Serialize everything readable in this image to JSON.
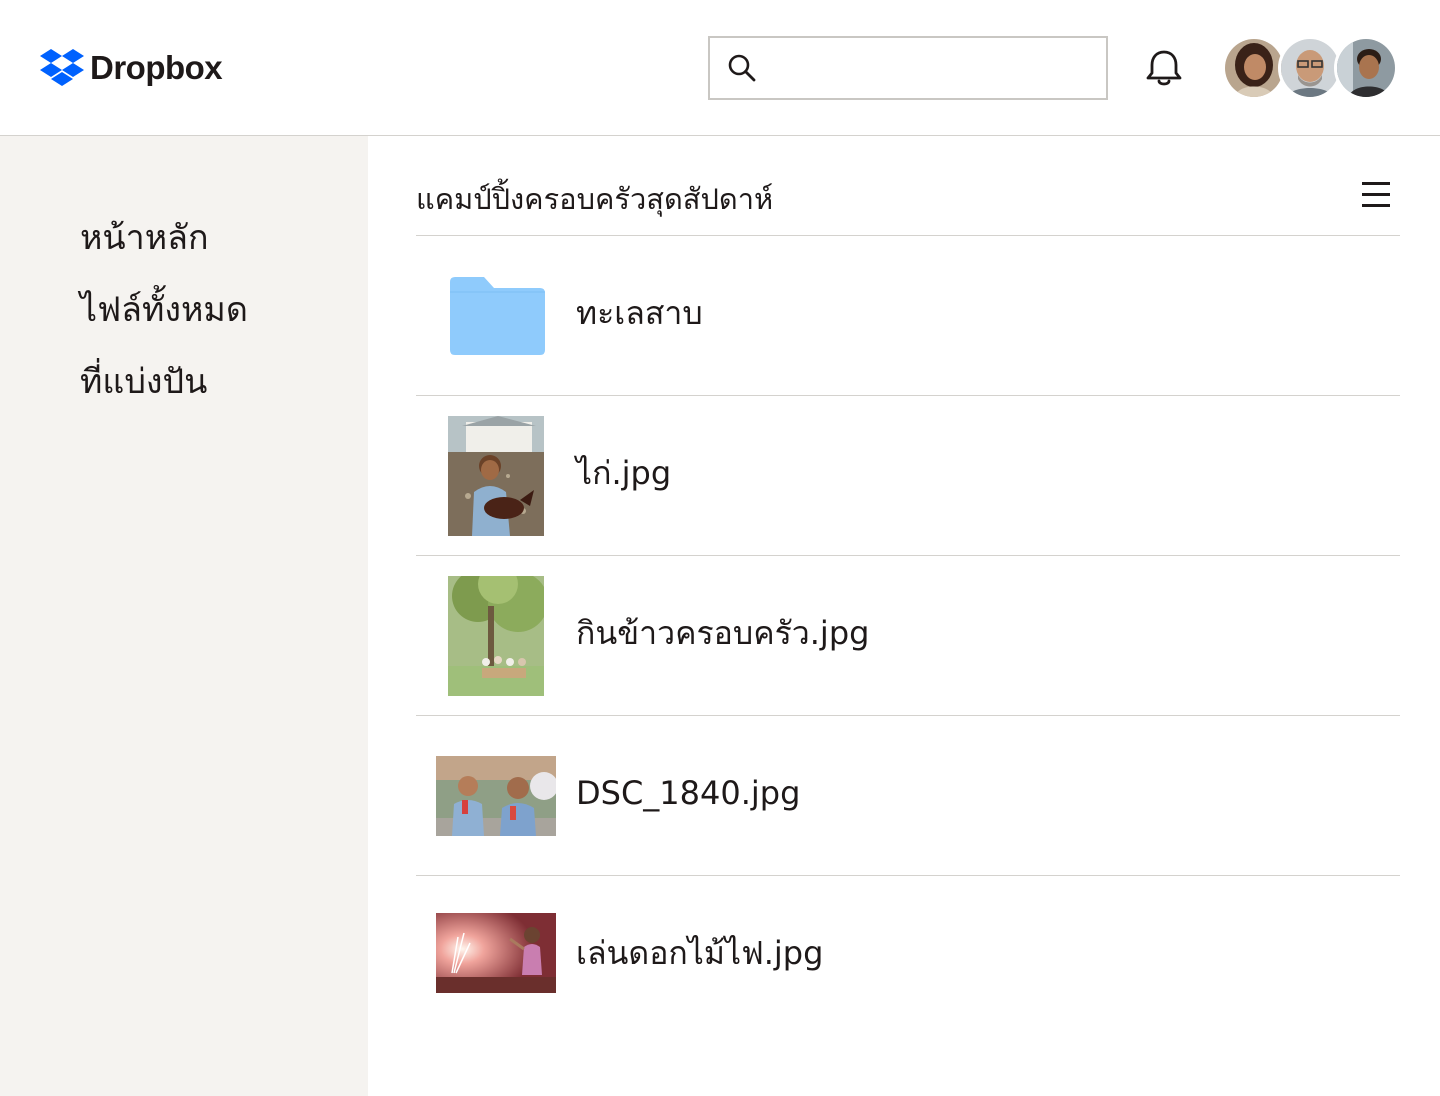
{
  "app": {
    "logo_text": "Dropbox",
    "brand_color": "#0061fe"
  },
  "header": {
    "search": {
      "value": "",
      "placeholder": "",
      "icon": "search-icon"
    },
    "notifications_icon": "bell-icon",
    "avatars": [
      "avatar-woman",
      "avatar-man-glasses",
      "avatar-man"
    ]
  },
  "sidebar": {
    "items": [
      {
        "label": "หน้าหลัก"
      },
      {
        "label": "ไฟล์ทั้งหมด"
      },
      {
        "label": "ที่แบ่งปัน"
      }
    ]
  },
  "main": {
    "breadcrumb": "แคมป์ปิ้งครอบครัวสุดสัปดาห์",
    "menu_icon": "hamburger-menu-icon",
    "files": [
      {
        "name": "ทะเลสาบ",
        "kind": "folder",
        "color": "#8fcbfc"
      },
      {
        "name": "ไก่.jpg",
        "kind": "image"
      },
      {
        "name": "กินข้าวครอบครัว.jpg",
        "kind": "image"
      },
      {
        "name": "DSC_1840.jpg",
        "kind": "image"
      },
      {
        "name": "เล่นดอกไม้ไฟ.jpg",
        "kind": "image"
      }
    ]
  }
}
